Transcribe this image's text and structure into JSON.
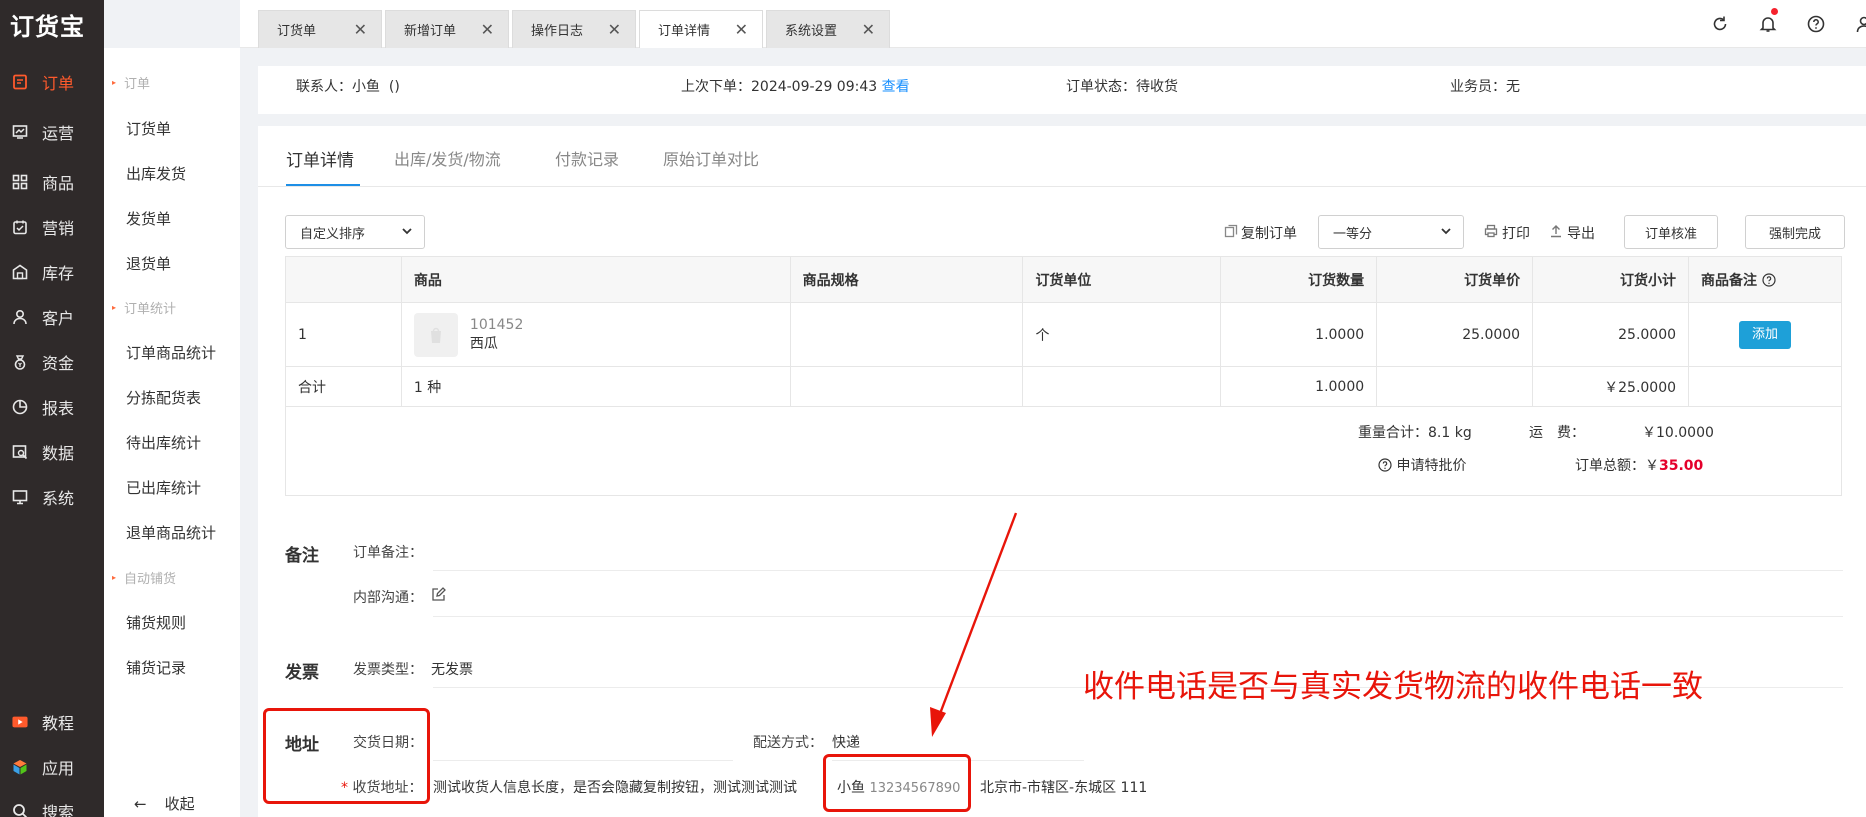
{
  "app": {
    "logo": "订货宝"
  },
  "sidebar": {
    "items": [
      {
        "label": "订单",
        "icon": "order-icon"
      },
      {
        "label": "运营",
        "icon": "operation-icon"
      },
      {
        "label": "商品",
        "icon": "goods-icon"
      },
      {
        "label": "营销",
        "icon": "marketing-icon"
      },
      {
        "label": "库存",
        "icon": "warehouse-icon"
      },
      {
        "label": "客户",
        "icon": "customer-icon"
      },
      {
        "label": "资金",
        "icon": "money-icon"
      },
      {
        "label": "报表",
        "icon": "report-icon"
      },
      {
        "label": "数据",
        "icon": "data-icon"
      },
      {
        "label": "系统",
        "icon": "system-icon"
      }
    ],
    "bottom": [
      {
        "label": "教程",
        "icon": "tutorial-icon"
      },
      {
        "label": "应用",
        "icon": "apps-icon"
      },
      {
        "label": "搜索",
        "icon": "search-icon"
      }
    ]
  },
  "submenu": {
    "groups": [
      "订单",
      "订单统计",
      "自动铺货"
    ],
    "items": [
      "订货单",
      "出库发货",
      "发货单",
      "退货单",
      "订单商品统计",
      "分拣配货表",
      "待出库统计",
      "已出库统计",
      "退单商品统计",
      "铺货规则",
      "铺货记录"
    ],
    "collapse": "收起"
  },
  "tabs": [
    "订货单",
    "新增订单",
    "操作日志",
    "订单详情",
    "系统设置"
  ],
  "header": {
    "contact_label": "联系人：小鱼",
    "contact_extra": "()",
    "last_order_label": "上次下单：2024-09-29 09:43",
    "view_link": "查看",
    "status": "订单状态：待收货",
    "salesman": "业务员：无"
  },
  "detail_tabs": [
    "订单详情",
    "出库/发货/物流",
    "付款记录",
    "原始订单对比"
  ],
  "toolbar": {
    "sort_select": "自定义排序",
    "copy_order": "复制订单",
    "grade_select": "一等分",
    "print": "打印",
    "export": "导出",
    "verify": "订单核准",
    "force_complete": "强制完成"
  },
  "table": {
    "headers": [
      "",
      "商品",
      "商品规格",
      "订货单位",
      "订货数量",
      "订货单价",
      "订货小计",
      "商品备注"
    ],
    "row": {
      "index": "1",
      "code": "101452",
      "name": "西瓜",
      "spec": "",
      "unit": "个",
      "qty": "1.0000",
      "price": "25.0000",
      "subtotal": "25.0000",
      "add": "添加"
    },
    "sum": {
      "label": "合计",
      "kinds": "1 种",
      "qty": "1.0000",
      "subtotal": "￥25.0000"
    }
  },
  "totals": {
    "weight": "重量合计：8.1 kg",
    "freight_label": "运　费：",
    "freight": "￥10.0000",
    "special_price": "申请特批价",
    "total_label": "订单总额：￥",
    "total": "35.00"
  },
  "remarks": {
    "title": "备注",
    "order_remark": "订单备注：",
    "internal": "内部沟通："
  },
  "invoice": {
    "title": "发票",
    "type_label": "发票类型：",
    "type": "无发票"
  },
  "address": {
    "title": "地址",
    "date_label": "交货日期：",
    "delivery_label": "配送方式：",
    "delivery": "快递",
    "addr_label": "收货地址：",
    "addr_text": "测试收货人信息长度，是否会隐藏复制按钮，测试测试测试",
    "receiver": "小鱼",
    "phone": "13234567890",
    "region": "北京市-市辖区-东城区 111"
  },
  "annotation": "收件电话是否与真实发货物流的收件电话一致",
  "colors": {
    "sidebar": "#2f2a2a",
    "accent": "#ff5a2c",
    "link": "#1890ff",
    "primary_button": "#1ea0d8",
    "annotation": "#e8150a"
  }
}
